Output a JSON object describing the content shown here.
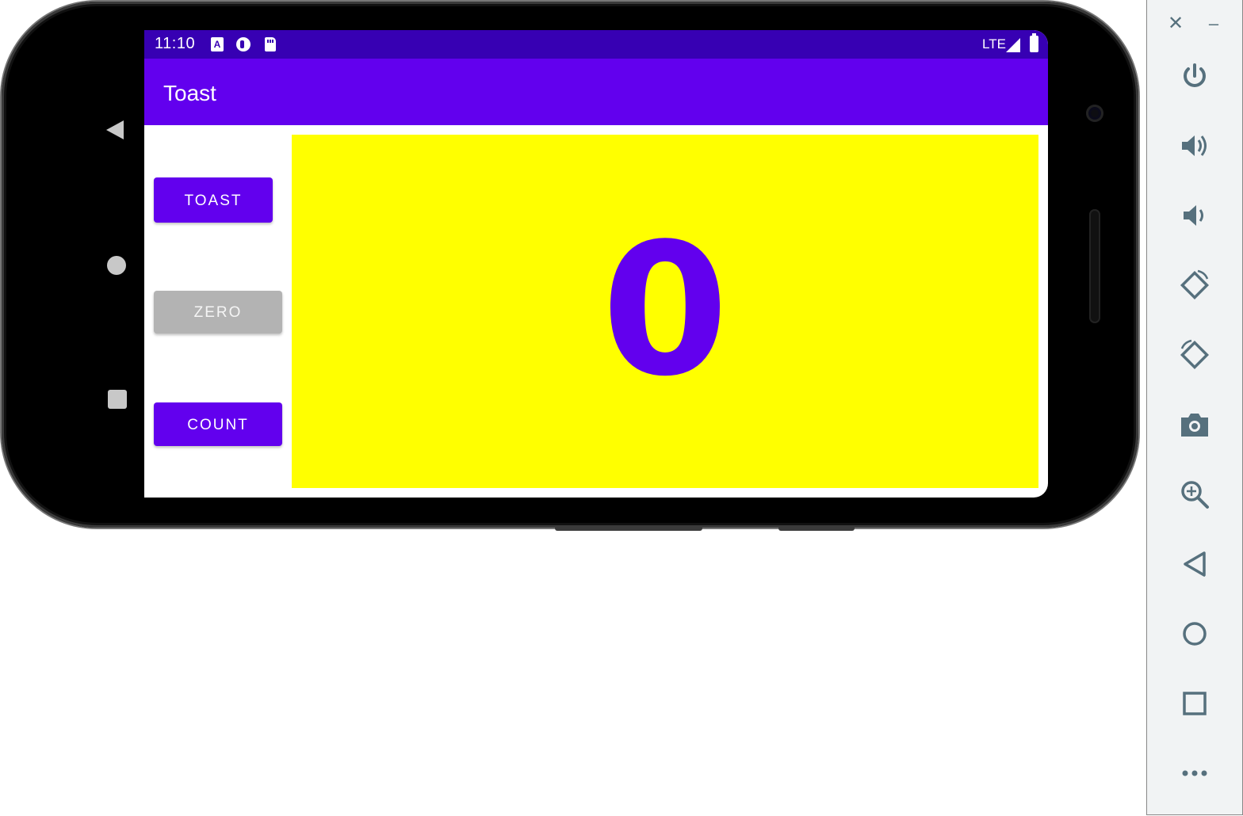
{
  "status_bar": {
    "time": "11:10",
    "network": "LTE"
  },
  "app_bar": {
    "title": "Toast"
  },
  "buttons": {
    "toast": "TOAST",
    "zero": "ZERO",
    "count": "COUNT"
  },
  "counter": {
    "value": "0"
  },
  "colors": {
    "status_bar": "#3700b3",
    "app_bar": "#6200ee",
    "counter_background": "#ffff00",
    "counter_text": "#6200ee",
    "zero_button": "#b3b3b3"
  },
  "emulator_toolbar": {
    "items": [
      "close-icon",
      "minimize-icon",
      "power-icon",
      "volume-up-icon",
      "volume-down-icon",
      "rotate-left-icon",
      "rotate-right-icon",
      "camera-icon",
      "zoom-icon",
      "back-icon",
      "home-icon",
      "overview-icon",
      "more-icon"
    ]
  }
}
